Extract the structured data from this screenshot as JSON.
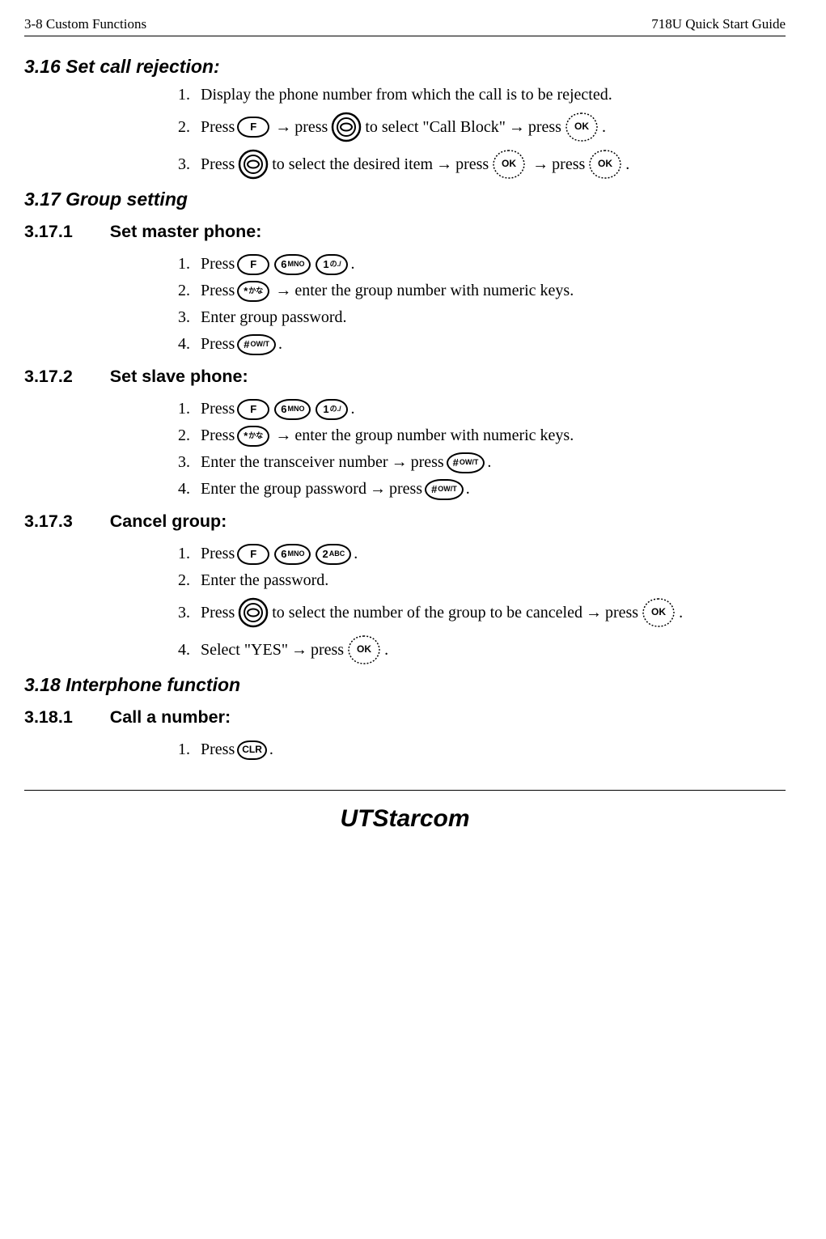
{
  "header": {
    "left": "3-8    Custom Functions",
    "right": "718U Quick Start Guide"
  },
  "s316": {
    "title": "3.16 Set call rejection:",
    "steps": [
      {
        "n": "1.",
        "t1": "Display the phone number from which the call is to be rejected."
      },
      {
        "n": "2.",
        "t1": "Press ",
        "t2": " press ",
        "t3": " to select \"Call Block\" ",
        "t4": " press ",
        "t5": "."
      },
      {
        "n": "3.",
        "t1": "Press ",
        "t2": " to select the desired item ",
        "t3": " press ",
        "t4": " press ",
        "t5": "."
      }
    ]
  },
  "s317": {
    "title": "3.17 Group setting",
    "s1": {
      "num": "3.17.1",
      "title": "Set master phone:",
      "steps": [
        {
          "n": "1.",
          "t1": "Press ",
          "t2": "."
        },
        {
          "n": "2.",
          "t1": "Press ",
          "t2": " enter the group number with numeric keys."
        },
        {
          "n": "3.",
          "t1": "Enter group password."
        },
        {
          "n": "4.",
          "t1": "Press ",
          "t2": "."
        }
      ]
    },
    "s2": {
      "num": "3.17.2",
      "title": "Set slave phone:",
      "steps": [
        {
          "n": "1.",
          "t1": "Press ",
          "t2": "."
        },
        {
          "n": "2.",
          "t1": "Press ",
          "t2": " enter the group number with numeric keys."
        },
        {
          "n": "3.",
          "t1": "Enter the transceiver number ",
          "t2": " press ",
          "t3": "."
        },
        {
          "n": "4.",
          "t1": "Enter the group password ",
          "t2": " press ",
          "t3": "."
        }
      ]
    },
    "s3": {
      "num": "3.17.3",
      "title": "Cancel group:",
      "steps": [
        {
          "n": "1.",
          "t1": "Press ",
          "t2": "."
        },
        {
          "n": "2.",
          "t1": "Enter the password."
        },
        {
          "n": "3.",
          "t1": "Press ",
          "t2": "to select the number of the group to be canceled ",
          "t3": " press ",
          "t4": "."
        },
        {
          "n": "4.",
          "t1": "Select \"YES\" ",
          "t2": " press ",
          "t3": "."
        }
      ]
    }
  },
  "s318": {
    "title": "3.18 Interphone function",
    "s1": {
      "num": "3.18.1",
      "title": "Call a number:",
      "steps": [
        {
          "n": "1.",
          "t1": "Press ",
          "t2": "."
        }
      ]
    }
  },
  "footer": {
    "logo1": "UT",
    "logo2": "Starcom"
  },
  "keys": {
    "F": "F",
    "OK": "OK",
    "6": "6",
    "6s": "MNO",
    "1": "1",
    "1s": "の./",
    "2": "2",
    "2s": "ABC",
    "star": "*",
    "stars": "かな",
    "hash": "#",
    "hashs": "OW/T",
    "clr": "CLR"
  },
  "arrow": "→"
}
